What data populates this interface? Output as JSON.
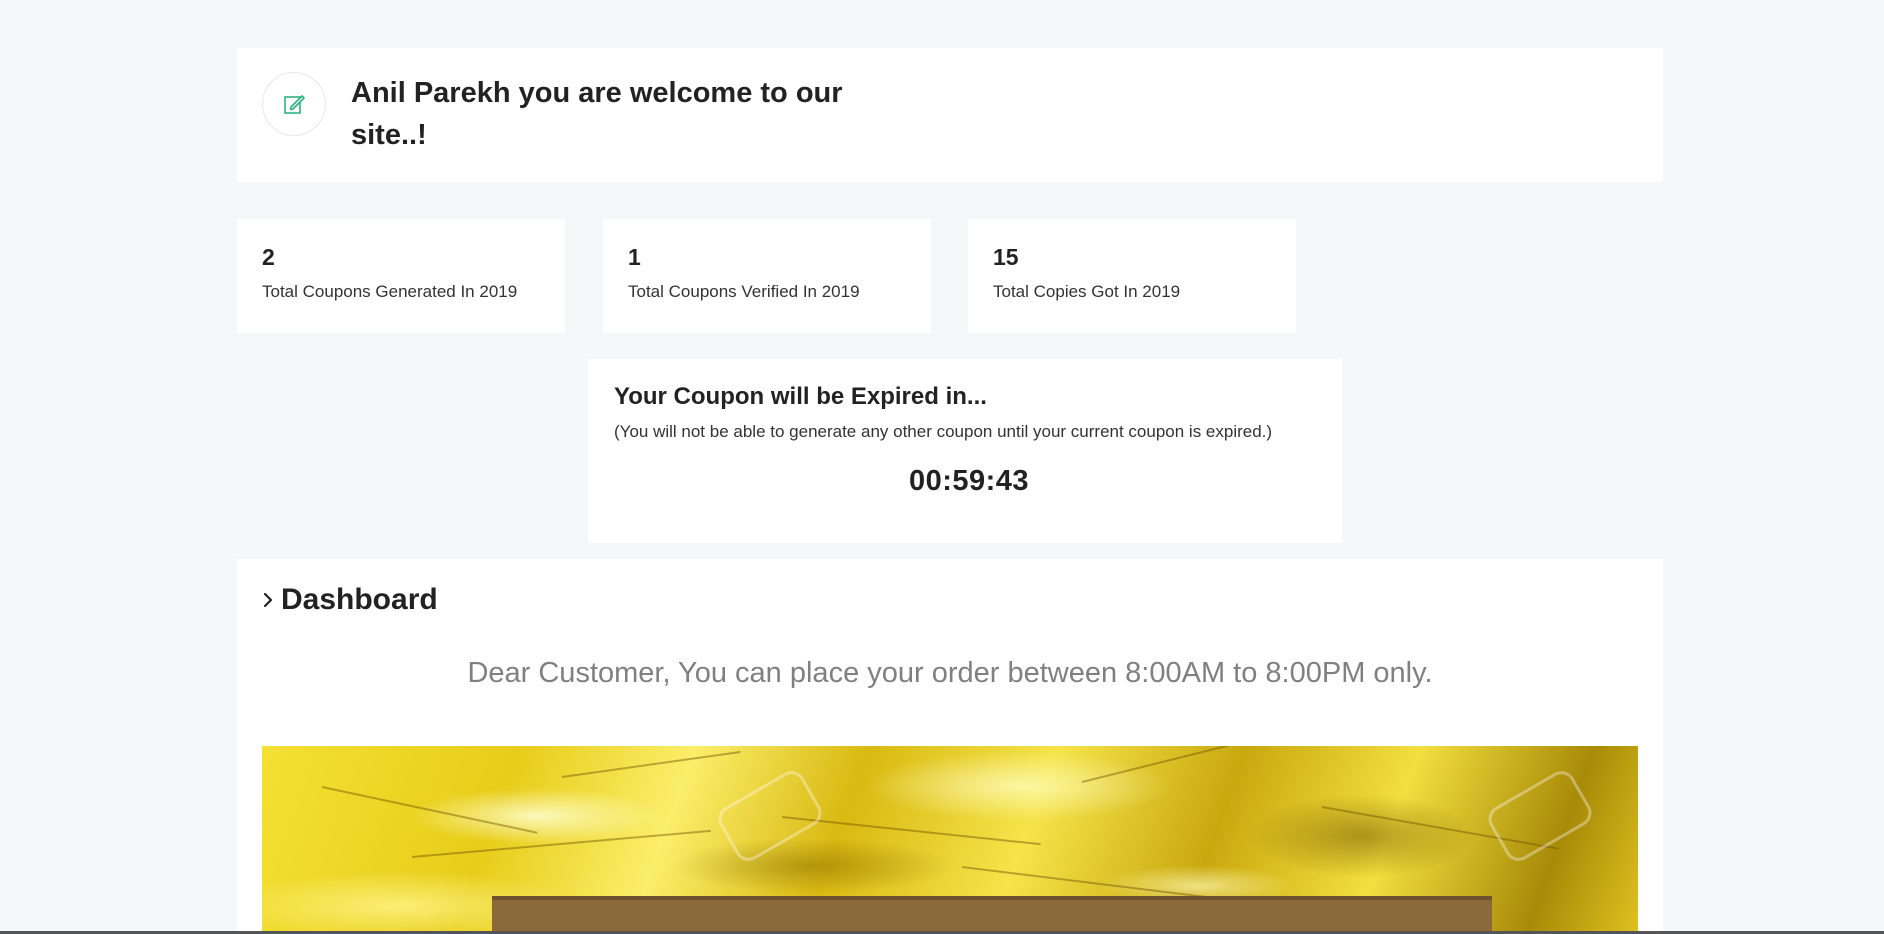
{
  "welcome": {
    "title": "Anil Parekh you are welcome to our site..!",
    "icon": "edit-icon",
    "accent_color": "#2fb380"
  },
  "stats": [
    {
      "value": "2",
      "label": "Total Coupons Generated In 2019"
    },
    {
      "value": "1",
      "label": "Total Coupons Verified In 2019"
    },
    {
      "value": "15",
      "label": "Total Copies Got In 2019"
    }
  ],
  "expiry": {
    "title": "Your Coupon will be Expired in...",
    "note": "(You will not be able to generate any other coupon until your current coupon is expired.)",
    "timer": "00:59:43"
  },
  "dashboard": {
    "title": "Dashboard",
    "icon": "chevron-right-icon",
    "notice": "Dear Customer, You can place your order between 8:00AM to 8:00PM only."
  },
  "colors": {
    "background": "#f6f7f9",
    "card": "#ffffff",
    "notice_text": "#808080",
    "banner_gold": "#e8cd1a"
  }
}
